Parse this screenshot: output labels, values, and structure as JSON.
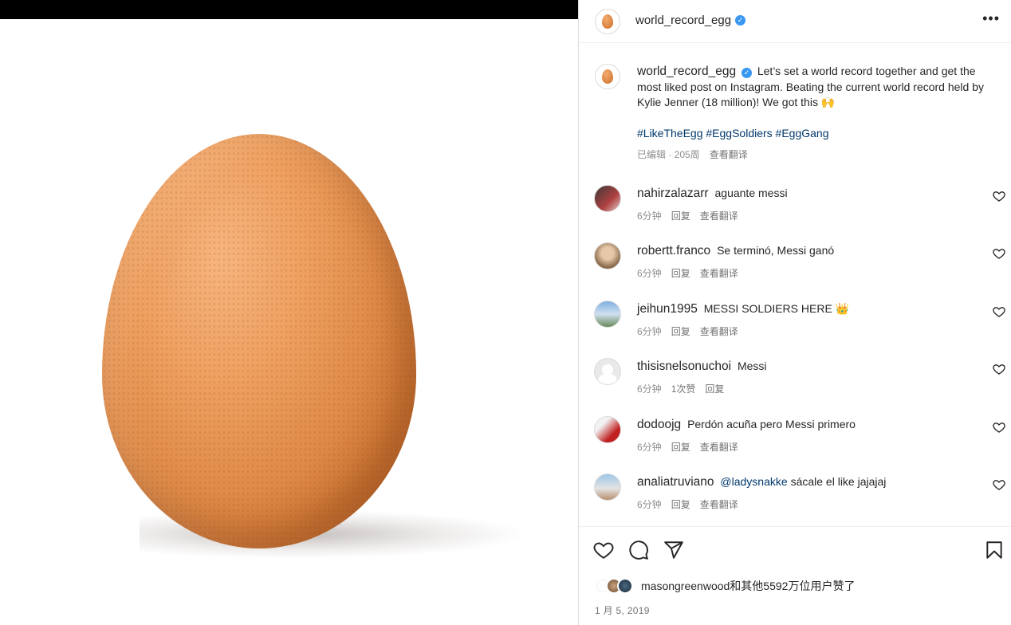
{
  "post": {
    "author": "world_record_egg",
    "verified_mark": "✓",
    "more_label": "•••"
  },
  "caption": {
    "username": "world_record_egg",
    "text": "Let’s set a world record together and get the most liked post on Instagram. Beating the current world record held by Kylie Jenner (18 million)! We got this 🙌",
    "hashtags": "#LikeTheEgg #EggSoldiers #EggGang",
    "edited": "已编辑 · 205周",
    "translate": "查看翻译"
  },
  "comments": [
    {
      "username": "nahirzalazarr",
      "text": "aguante messi",
      "time": "6分钟",
      "reply": "回复",
      "translate": "查看翻译"
    },
    {
      "username": "robertt.franco",
      "text": "Se terminó, Messi ganó",
      "time": "6分钟",
      "reply": "回复",
      "translate": "查看翻译"
    },
    {
      "username": "jeihun1995",
      "text": "MESSI SOLDIERS HERE 👑",
      "time": "6分钟",
      "reply": "回复",
      "translate": "查看翻译"
    },
    {
      "username": "thisisnelsonuchoi",
      "text": "Messi",
      "time": "6分钟",
      "likes": "1次赞",
      "reply": "回复"
    },
    {
      "username": "dodoojg",
      "text": "Perdón acuña pero Messi primero",
      "time": "6分钟",
      "reply": "回复",
      "translate": "查看翻译"
    },
    {
      "username": "analiatruviano",
      "mention": "@ladysnakke",
      "text": "sácale el like jajajaj",
      "time": "6分钟",
      "reply": "回复",
      "translate": "查看翻译"
    }
  ],
  "footer": {
    "liked_by": "masongreenwood和其他5592万位用户赞了",
    "date": "1 月 5, 2019"
  },
  "icons": {
    "like": "heart-icon",
    "comment": "comment-icon",
    "share": "share-icon",
    "save": "bookmark-icon",
    "more": "more-icon"
  }
}
